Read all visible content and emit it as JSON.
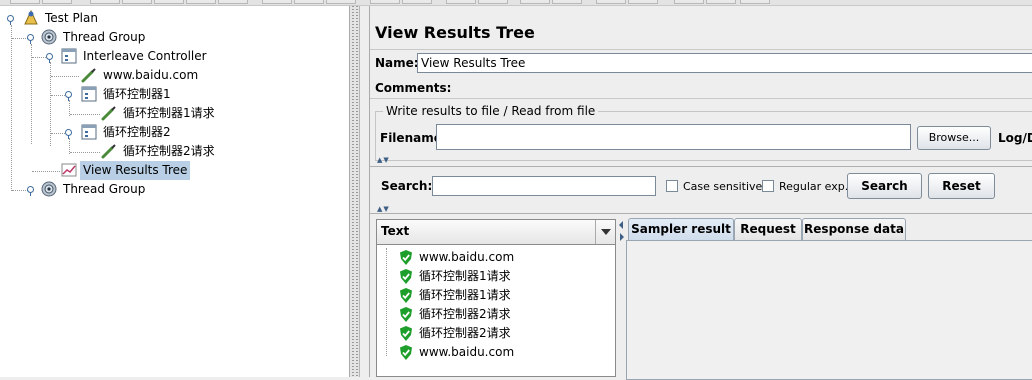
{
  "tree": {
    "test_plan": "Test Plan",
    "thread_group_1": "Thread Group",
    "interleave_controller": "Interleave Controller",
    "baidu_sampler": "www.baidu.com",
    "loop_controller_1": "循环控制器1",
    "loop_request_1": "循环控制器1请求",
    "loop_controller_2": "循环控制器2",
    "loop_request_2": "循环控制器2请求",
    "view_results_tree": "View Results Tree",
    "thread_group_2": "Thread Group"
  },
  "panel": {
    "title": "View Results Tree",
    "name_label": "Name:",
    "name_value": "View Results Tree",
    "comments_label": "Comments:",
    "file_group_title": "Write results to file / Read from file",
    "filename_label": "Filename",
    "filename_value": "",
    "browse_label": "Browse...",
    "log_label": "Log/Di",
    "search_label": "Search:",
    "search_value": "",
    "case_sensitive_label": "Case sensitive",
    "regex_label": "Regular exp.",
    "search_button": "Search",
    "reset_button": "Reset"
  },
  "results": {
    "header": "Text",
    "items": [
      "www.baidu.com",
      "循环控制器1请求",
      "循环控制器1请求",
      "循环控制器2请求",
      "循环控制器2请求",
      "www.baidu.com"
    ]
  },
  "tabs": [
    "Sampler result",
    "Request",
    "Response data"
  ],
  "colors": {
    "selection": "#b8cfe5",
    "success": "#1e9e2a",
    "accent": "#3d6d9e"
  }
}
